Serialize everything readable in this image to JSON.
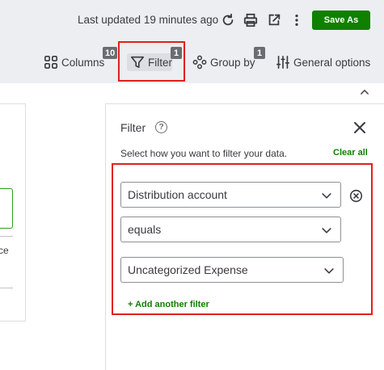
{
  "header": {
    "last_updated": "Last updated 19 minutes ago",
    "save_label": "Save As",
    "icons": [
      "refresh-icon",
      "print-icon",
      "export-icon",
      "more-icon"
    ]
  },
  "toolbar": {
    "columns_label": "Columns",
    "columns_count": "10",
    "filter_label": "Filter",
    "filter_count": "1",
    "group_by_label": "Group by",
    "group_by_count": "1",
    "general_options_label": "General options"
  },
  "left_panel": {
    "partial_text": "ce"
  },
  "filter_panel": {
    "title": "Filter",
    "help": "?",
    "subtitle": "Select how you want to filter your data.",
    "clear_all": "Clear all",
    "field": "Distribution account",
    "operator": "equals",
    "value": "Uncategorized Expense",
    "add_filter": "+ Add another filter"
  },
  "colors": {
    "accent_green": "#108000",
    "highlight_red": "#e02020",
    "toolbar_bg": "#eceef1",
    "badge_gray": "#6b6c72"
  }
}
